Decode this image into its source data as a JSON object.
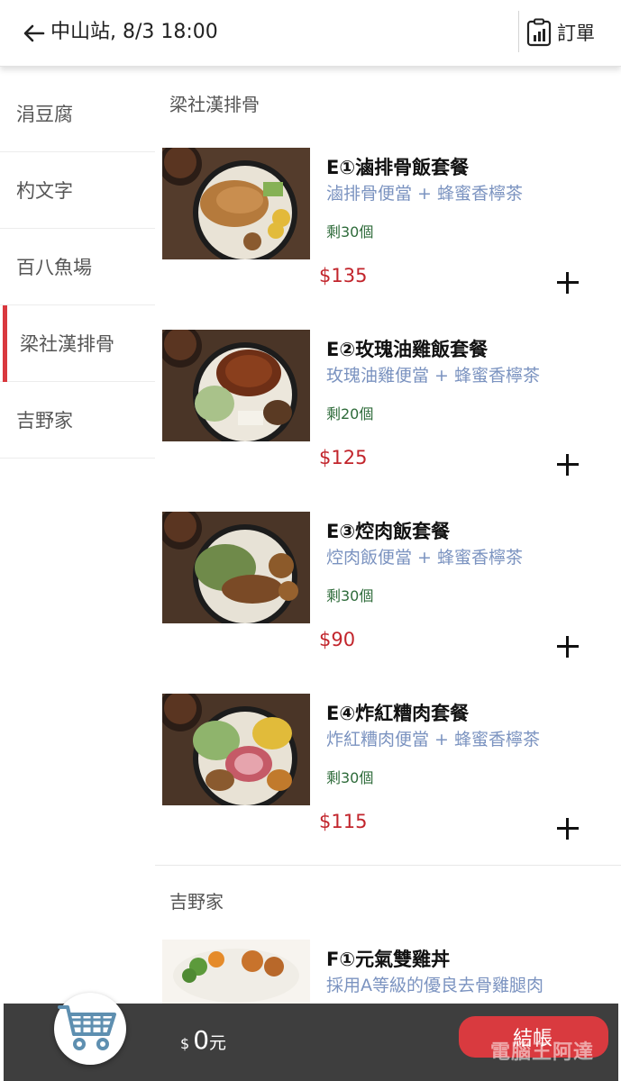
{
  "header": {
    "title": "中山站, 8/3 18:00",
    "orders_label": "訂單"
  },
  "sidebar": {
    "items": [
      {
        "label": "涓豆腐"
      },
      {
        "label": "杓文字"
      },
      {
        "label": "百八魚場"
      },
      {
        "label": "梁社漢排骨",
        "active": true
      },
      {
        "label": "吉野家"
      }
    ]
  },
  "sections": [
    {
      "title": "梁社漢排骨",
      "items": [
        {
          "name": "E①滷排骨飯套餐",
          "desc": "滷排骨便當 + 蜂蜜香檸茶",
          "stock": "剩30個",
          "price": "$135"
        },
        {
          "name": "E②玫瑰油雞飯套餐",
          "desc": "玫瑰油雞便當 + 蜂蜜香檸茶",
          "stock": "剩20個",
          "price": "$125"
        },
        {
          "name": "E③焢肉飯套餐",
          "desc": "焢肉飯便當 + 蜂蜜香檸茶",
          "stock": "剩30個",
          "price": "$90"
        },
        {
          "name": "E④炸紅糟肉套餐",
          "desc": "炸紅糟肉便當 + 蜂蜜香檸茶",
          "stock": "剩30個",
          "price": "$115"
        }
      ]
    },
    {
      "title": "吉野家",
      "items": [
        {
          "name": "F①元氣雙雞丼",
          "desc": "採用A等級的優良去骨雞腿肉"
        }
      ]
    }
  ],
  "cart": {
    "currency": "$",
    "amount": "0",
    "unit": "元",
    "checkout_label": "結帳"
  },
  "watermark": "電腦王阿達",
  "colors": {
    "accent": "#d9383e",
    "price": "#c2252c",
    "desc": "#7b93c0",
    "stock": "#2e6b3a",
    "bottom_bar": "#3e3e3e"
  }
}
